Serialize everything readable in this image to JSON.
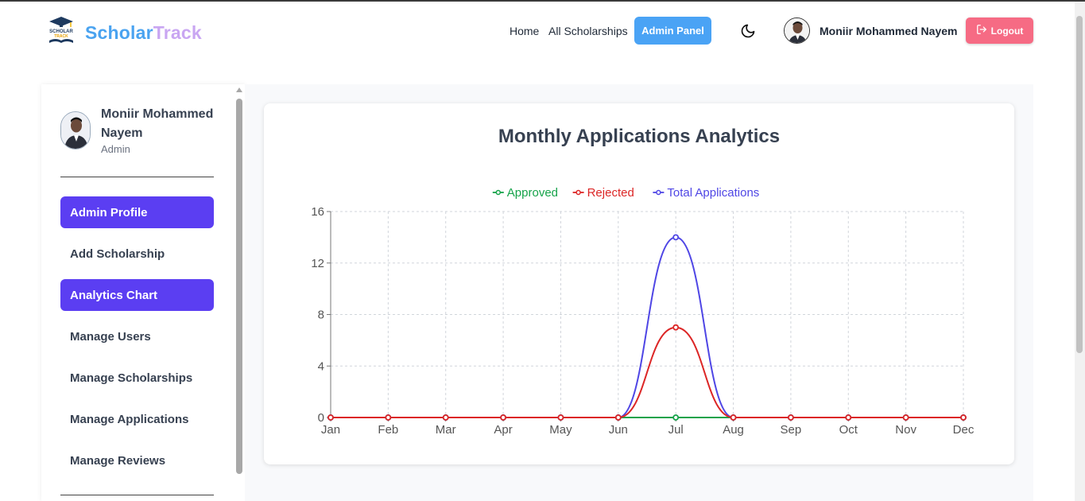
{
  "brand": {
    "part1": "Scholar",
    "part2": "Track",
    "logo_text_top": "SCHOLAR",
    "logo_text_bottom": "TRACK"
  },
  "nav": {
    "home": "Home",
    "all_scholarships": "All Scholarships",
    "admin_panel": "Admin Panel",
    "username": "Moniir Mohammed Nayem",
    "logout": "Logout"
  },
  "sidebar": {
    "name": "Moniir Mohammed Nayem",
    "role": "Admin",
    "items": [
      {
        "label": "Admin Profile",
        "active": true
      },
      {
        "label": "Add Scholarship",
        "active": false
      },
      {
        "label": "Analytics Chart",
        "active": true
      },
      {
        "label": "Manage Users",
        "active": false
      },
      {
        "label": "Manage Scholarships",
        "active": false
      },
      {
        "label": "Manage Applications",
        "active": false
      },
      {
        "label": "Manage Reviews",
        "active": false
      }
    ]
  },
  "main": {
    "card_title": "Monthly Applications Analytics"
  },
  "colors": {
    "approved": "#16a34a",
    "rejected": "#dc2626",
    "total": "#4f46e5",
    "accent": "#5b3ef2",
    "admin_btn": "#4aa3f5",
    "logout_btn": "#f66b84"
  },
  "chart_data": {
    "type": "line",
    "title": "",
    "categories": [
      "Jan",
      "Feb",
      "Mar",
      "Apr",
      "May",
      "Jun",
      "Jul",
      "Aug",
      "Sep",
      "Oct",
      "Nov",
      "Dec"
    ],
    "ylim": [
      0,
      16
    ],
    "yticks": [
      0,
      4,
      8,
      12,
      16
    ],
    "grid": true,
    "legend": "top-center",
    "series": [
      {
        "name": "Approved",
        "values": [
          0,
          0,
          0,
          0,
          0,
          0,
          0,
          0,
          0,
          0,
          0,
          0
        ],
        "color": "#16a34a"
      },
      {
        "name": "Rejected",
        "values": [
          0,
          0,
          0,
          0,
          0,
          0,
          7,
          0,
          0,
          0,
          0,
          0
        ],
        "color": "#dc2626"
      },
      {
        "name": "Total Applications",
        "values": [
          0,
          0,
          0,
          0,
          0,
          0,
          14,
          0,
          0,
          0,
          0,
          0
        ],
        "color": "#4f46e5"
      }
    ]
  }
}
